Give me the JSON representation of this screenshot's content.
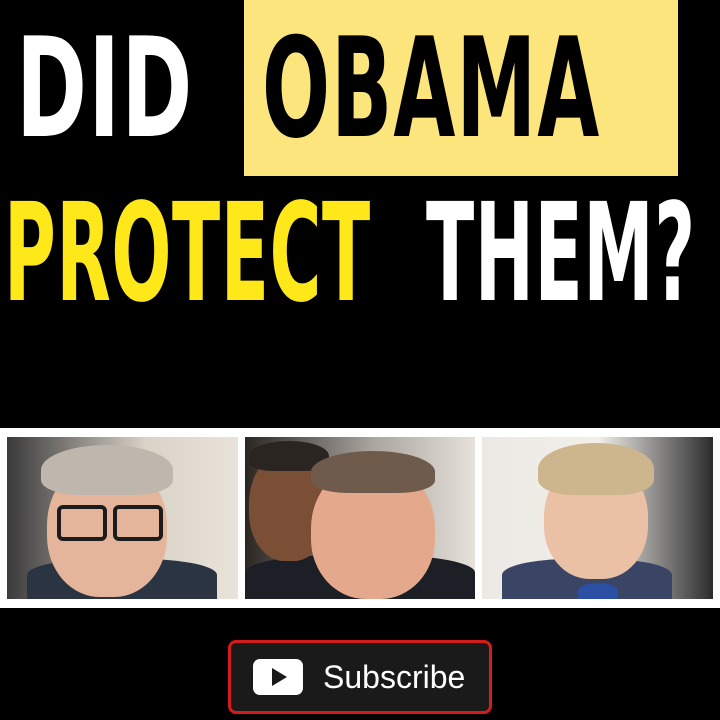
{
  "headline": {
    "line1": {
      "word1": "DID",
      "word2": "OBAMA"
    },
    "line2": {
      "word1": "PROTECT",
      "word2": "THEM?"
    }
  },
  "colors": {
    "background": "#000000",
    "highlight_box": "#fbe57c",
    "protect_text": "#ffe81a",
    "white_text": "#ffffff",
    "subscribe_border": "#d51c1c"
  },
  "photos": [
    {
      "icon": "portrait-man-glasses"
    },
    {
      "icon": "portrait-two-men-smiling"
    },
    {
      "icon": "portrait-woman-medal"
    }
  ],
  "subscribe": {
    "label": "Subscribe",
    "icon": "play-icon"
  }
}
